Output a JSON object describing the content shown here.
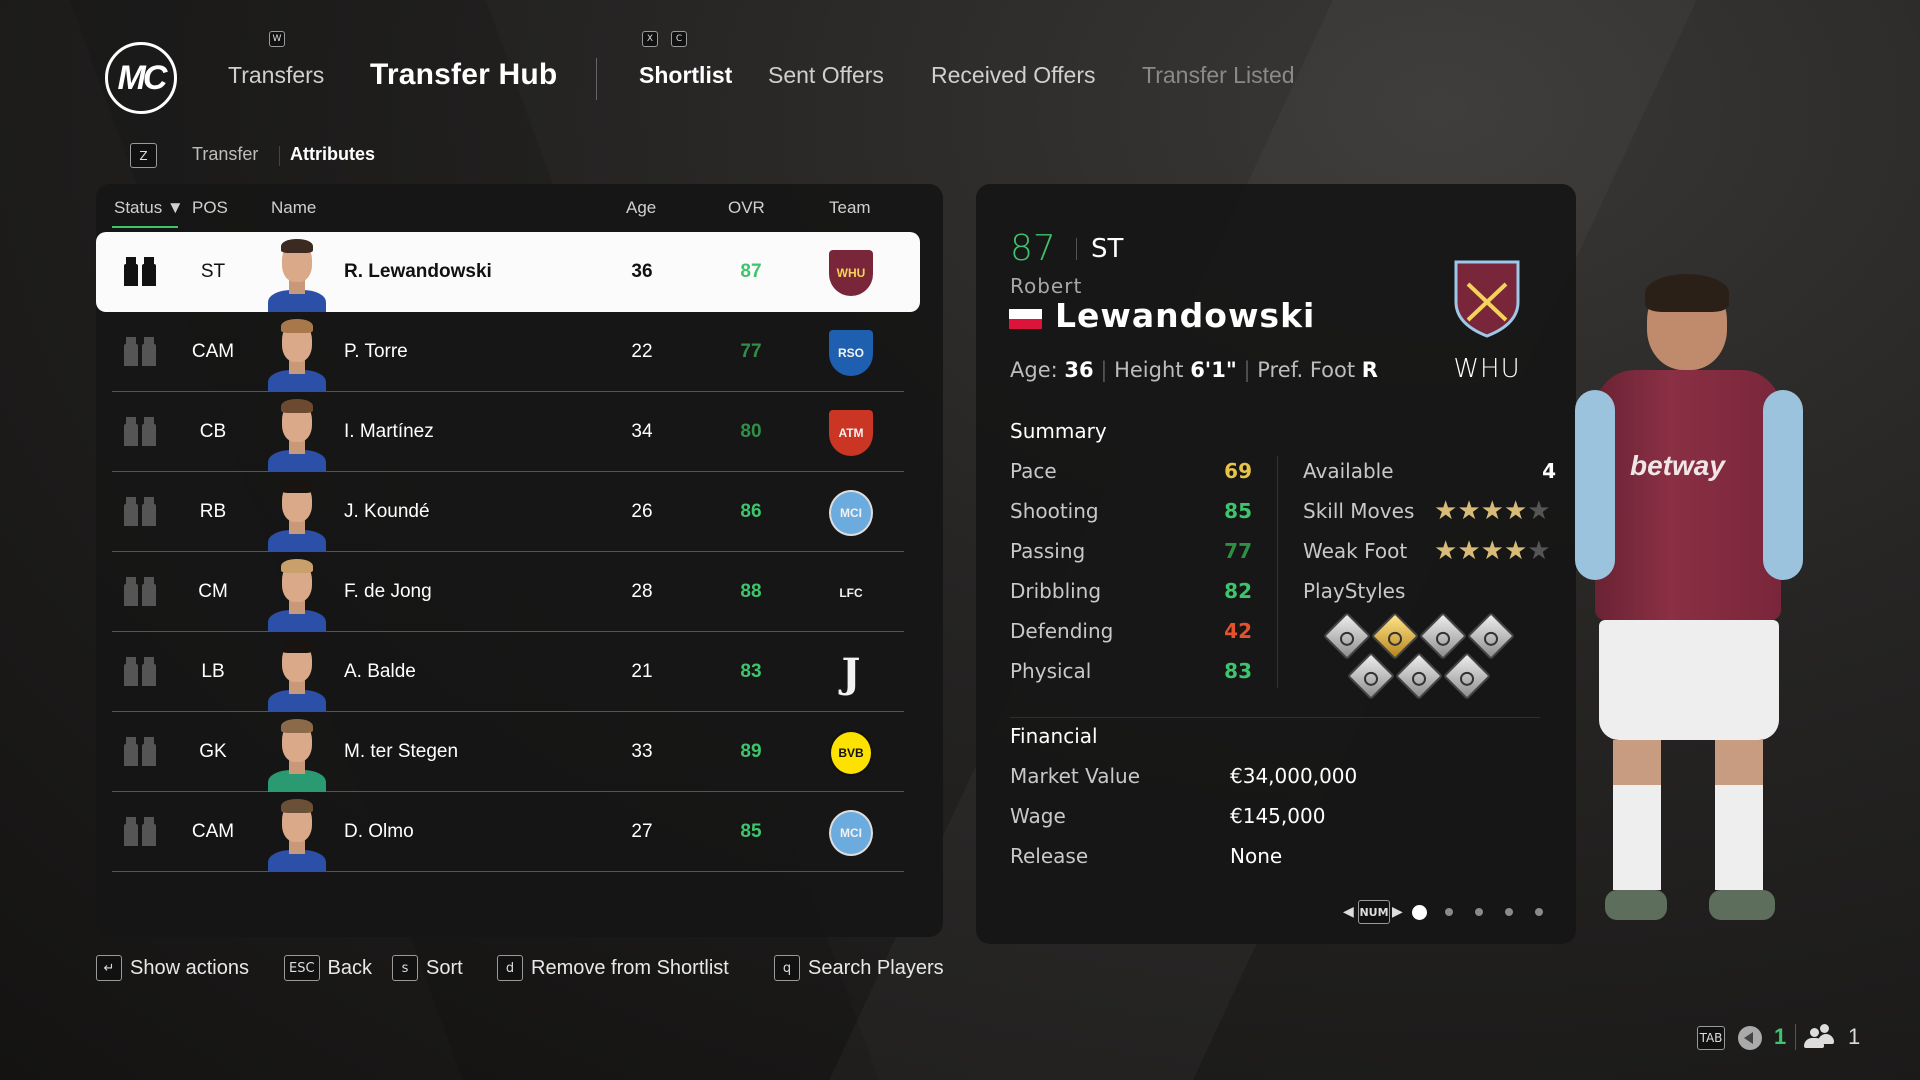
{
  "header": {
    "logo": "MC",
    "nav": {
      "transfers": "Transfers",
      "transfers_key": "W",
      "hub": "Transfer Hub",
      "tabs_key_prev": "X",
      "tabs_key_next": "C",
      "tabs": [
        {
          "label": "Shortlist",
          "state": "active"
        },
        {
          "label": "Sent Offers",
          "state": "normal"
        },
        {
          "label": "Received Offers",
          "state": "normal"
        },
        {
          "label": "Transfer Listed",
          "state": "disabled"
        }
      ]
    },
    "subtabs_key": "Z",
    "subtabs": [
      "Transfer",
      "Attributes"
    ],
    "subtab_active": "Attributes"
  },
  "table": {
    "columns": {
      "status": "Status ▼",
      "pos": "POS",
      "name": "Name",
      "age": "Age",
      "ovr": "OVR",
      "team": "Team"
    },
    "rows": [
      {
        "pos": "ST",
        "name": "R. Lewandowski",
        "age": "36",
        "ovr": "87",
        "ovr_color": "#3ec46d",
        "team": "West Ham United",
        "team_abbr": "WHU",
        "crest": "#7a263a",
        "crest2": "#f3d459",
        "hair": "#3a2a20",
        "shirt": "#2c4fa8",
        "selected": true
      },
      {
        "pos": "CAM",
        "name": "P. Torre",
        "age": "22",
        "ovr": "77",
        "ovr_color": "#2f8f47",
        "team": "Real Sociedad",
        "team_abbr": "RSO",
        "crest": "#1f5fb0",
        "crest2": "#f2f2f2",
        "hair": "#a9784a",
        "shirt": "#2c4fa8"
      },
      {
        "pos": "CB",
        "name": "I. Martínez",
        "age": "34",
        "ovr": "80",
        "ovr_color": "#2f8f47",
        "team": "Atlético de Madrid",
        "team_abbr": "ATM",
        "crest": "#cb3524",
        "crest2": "#f2f2f2",
        "hair": "#6b4a30",
        "shirt": "#2c4fa8"
      },
      {
        "pos": "RB",
        "name": "J. Koundé",
        "age": "26",
        "ovr": "86",
        "ovr_color": "#3ec46d",
        "team": "Manchester City",
        "team_abbr": "MCI",
        "crest": "#6cabdd",
        "crest2": "#f2f2f2",
        "hair": "#1a1410",
        "shirt": "#2c4fa8"
      },
      {
        "pos": "CM",
        "name": "F. de Jong",
        "age": "28",
        "ovr": "88",
        "ovr_color": "#3ec46d",
        "team": "Liverpool",
        "team_abbr": "LFC",
        "crest": "transparent",
        "crest2": "#f2f2f2",
        "hair": "#c9a06a",
        "shirt": "#2c4fa8"
      },
      {
        "pos": "LB",
        "name": "A. Balde",
        "age": "21",
        "ovr": "83",
        "ovr_color": "#3ec46d",
        "team": "Juventus",
        "team_abbr": "J",
        "crest": "transparent",
        "crest2": "#f2f2f2",
        "hair": "#1a1410",
        "shirt": "#2c4fa8"
      },
      {
        "pos": "GK",
        "name": "M. ter Stegen",
        "age": "33",
        "ovr": "89",
        "ovr_color": "#3ec46d",
        "team": "Borussia Dortmund",
        "team_abbr": "BVB",
        "crest": "#fde100",
        "crest2": "#111111",
        "hair": "#8a6a48",
        "shirt": "#2a9a72"
      },
      {
        "pos": "CAM",
        "name": "D. Olmo",
        "age": "27",
        "ovr": "85",
        "ovr_color": "#3ec46d",
        "team": "Manchester City",
        "team_abbr": "MCI",
        "crest": "#6cabdd",
        "crest2": "#f2f2f2",
        "hair": "#6b5038",
        "shirt": "#2c4fa8"
      }
    ]
  },
  "detail": {
    "ovr": "87",
    "pos": "ST",
    "first_name": "Robert",
    "last_name": "Lewandowski",
    "nation": "Poland",
    "age_label": "Age:",
    "age": "36",
    "height_label": "Height",
    "height": "6'1\"",
    "foot_label": "Pref. Foot",
    "foot": "R",
    "club_abbr": "WHU",
    "summary_title": "Summary",
    "stats": [
      {
        "label": "Pace",
        "value": "69",
        "color": "#e8c34a"
      },
      {
        "label": "Shooting",
        "value": "85",
        "color": "#3ec46d"
      },
      {
        "label": "Passing",
        "value": "77",
        "color": "#2f8f47"
      },
      {
        "label": "Dribbling",
        "value": "82",
        "color": "#3ec46d"
      },
      {
        "label": "Defending",
        "value": "42",
        "color": "#e5522e"
      },
      {
        "label": "Physical",
        "value": "83",
        "color": "#3ec46d"
      }
    ],
    "available_label": "Available",
    "available": "4",
    "skill_moves_label": "Skill Moves",
    "skill_moves": 4,
    "weak_foot_label": "Weak Foot",
    "weak_foot": 4,
    "playstyles_label": "PlayStyles",
    "playstyles": [
      "finesse-shot",
      "power-shot-plus",
      "power-shot",
      "header",
      "aerial",
      "first-touch",
      "trickster"
    ],
    "playstyle_plus_index": 1,
    "financial_title": "Financial",
    "financial": [
      {
        "label": "Market Value",
        "value": "€34,000,000"
      },
      {
        "label": "Wage",
        "value": "€145,000"
      },
      {
        "label": "Release",
        "value": "None"
      }
    ],
    "pager_key": "NUM",
    "pages": 5,
    "page_current": 1
  },
  "footer": {
    "actions": [
      {
        "key": "↵",
        "label": "Show actions"
      },
      {
        "key": "ESC",
        "label": "Back"
      },
      {
        "key": "s",
        "label": "Sort"
      },
      {
        "key": "d",
        "label": "Remove from Shortlist"
      },
      {
        "key": "q",
        "label": "Search Players"
      }
    ],
    "tab_key": "TAB",
    "voice_count": "1",
    "users_count": "1"
  }
}
